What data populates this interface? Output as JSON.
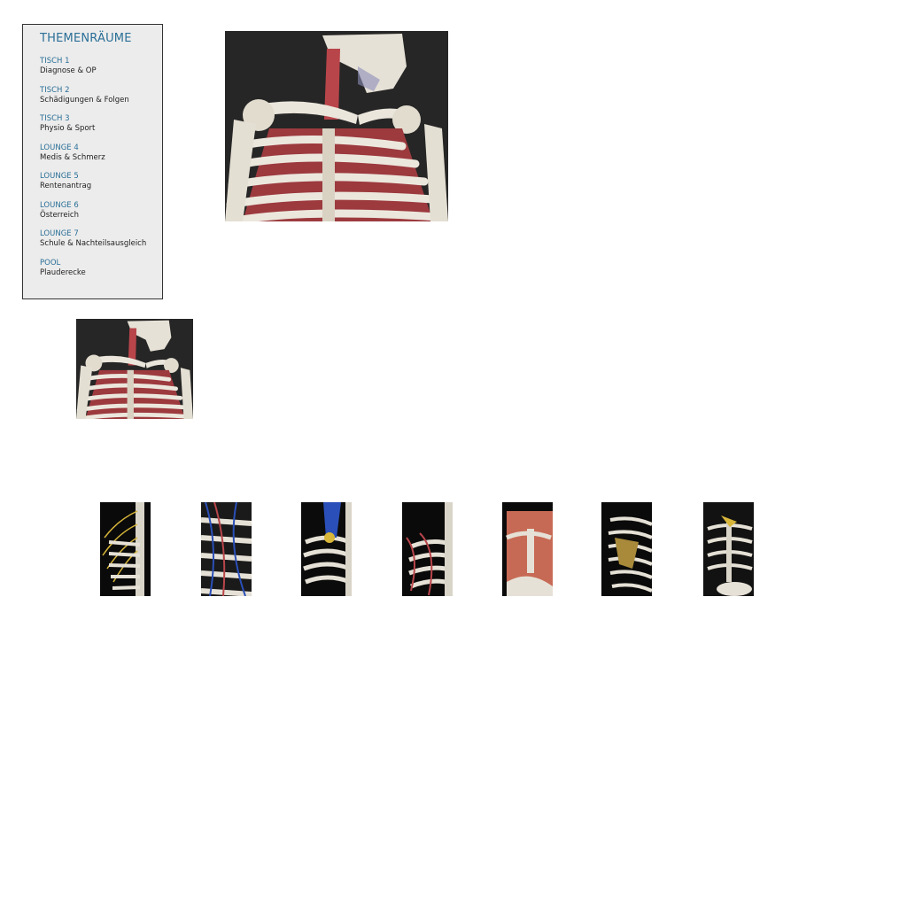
{
  "sidebar": {
    "title": "THEMENRÄUME",
    "rooms": [
      {
        "name": "TISCH 1",
        "desc": "Diagnose & OP"
      },
      {
        "name": "TISCH 2",
        "desc": "Schädigungen & Folgen"
      },
      {
        "name": "TISCH 3",
        "desc": "Physio & Sport"
      },
      {
        "name": "LOUNGE 4",
        "desc": "Medis & Schmerz"
      },
      {
        "name": "LOUNGE 5",
        "desc": "Rentenantrag"
      },
      {
        "name": "LOUNGE 6",
        "desc": "Österreich"
      },
      {
        "name": "LOUNGE 7",
        "desc": "Schule & Nachteilsausgleich"
      },
      {
        "name": "POOL",
        "desc": "Plauderecke"
      }
    ]
  },
  "colors": {
    "accent": "#2a6f97",
    "sidebar_bg": "#ececec",
    "bone": "#e8e4dc",
    "tissue_red": "#b8454a",
    "vein_blue": "#2a4fb8",
    "nerve_yellow": "#d8b63a",
    "muscle": "#c76a55"
  },
  "images": {
    "large": {
      "subject": "3D CT skeleton chest and skull"
    },
    "medium": {
      "subject": "3D CT skeleton chest and skull"
    },
    "thumbnails": [
      {
        "subject": "spine with nerves"
      },
      {
        "subject": "ribcage with blood vessels"
      },
      {
        "subject": "ribcage with vessels and nerves"
      },
      {
        "subject": "ribcage with arteries"
      },
      {
        "subject": "chest muscles"
      },
      {
        "subject": "ribcage with scapula"
      },
      {
        "subject": "ribcage skeleton"
      }
    ]
  }
}
